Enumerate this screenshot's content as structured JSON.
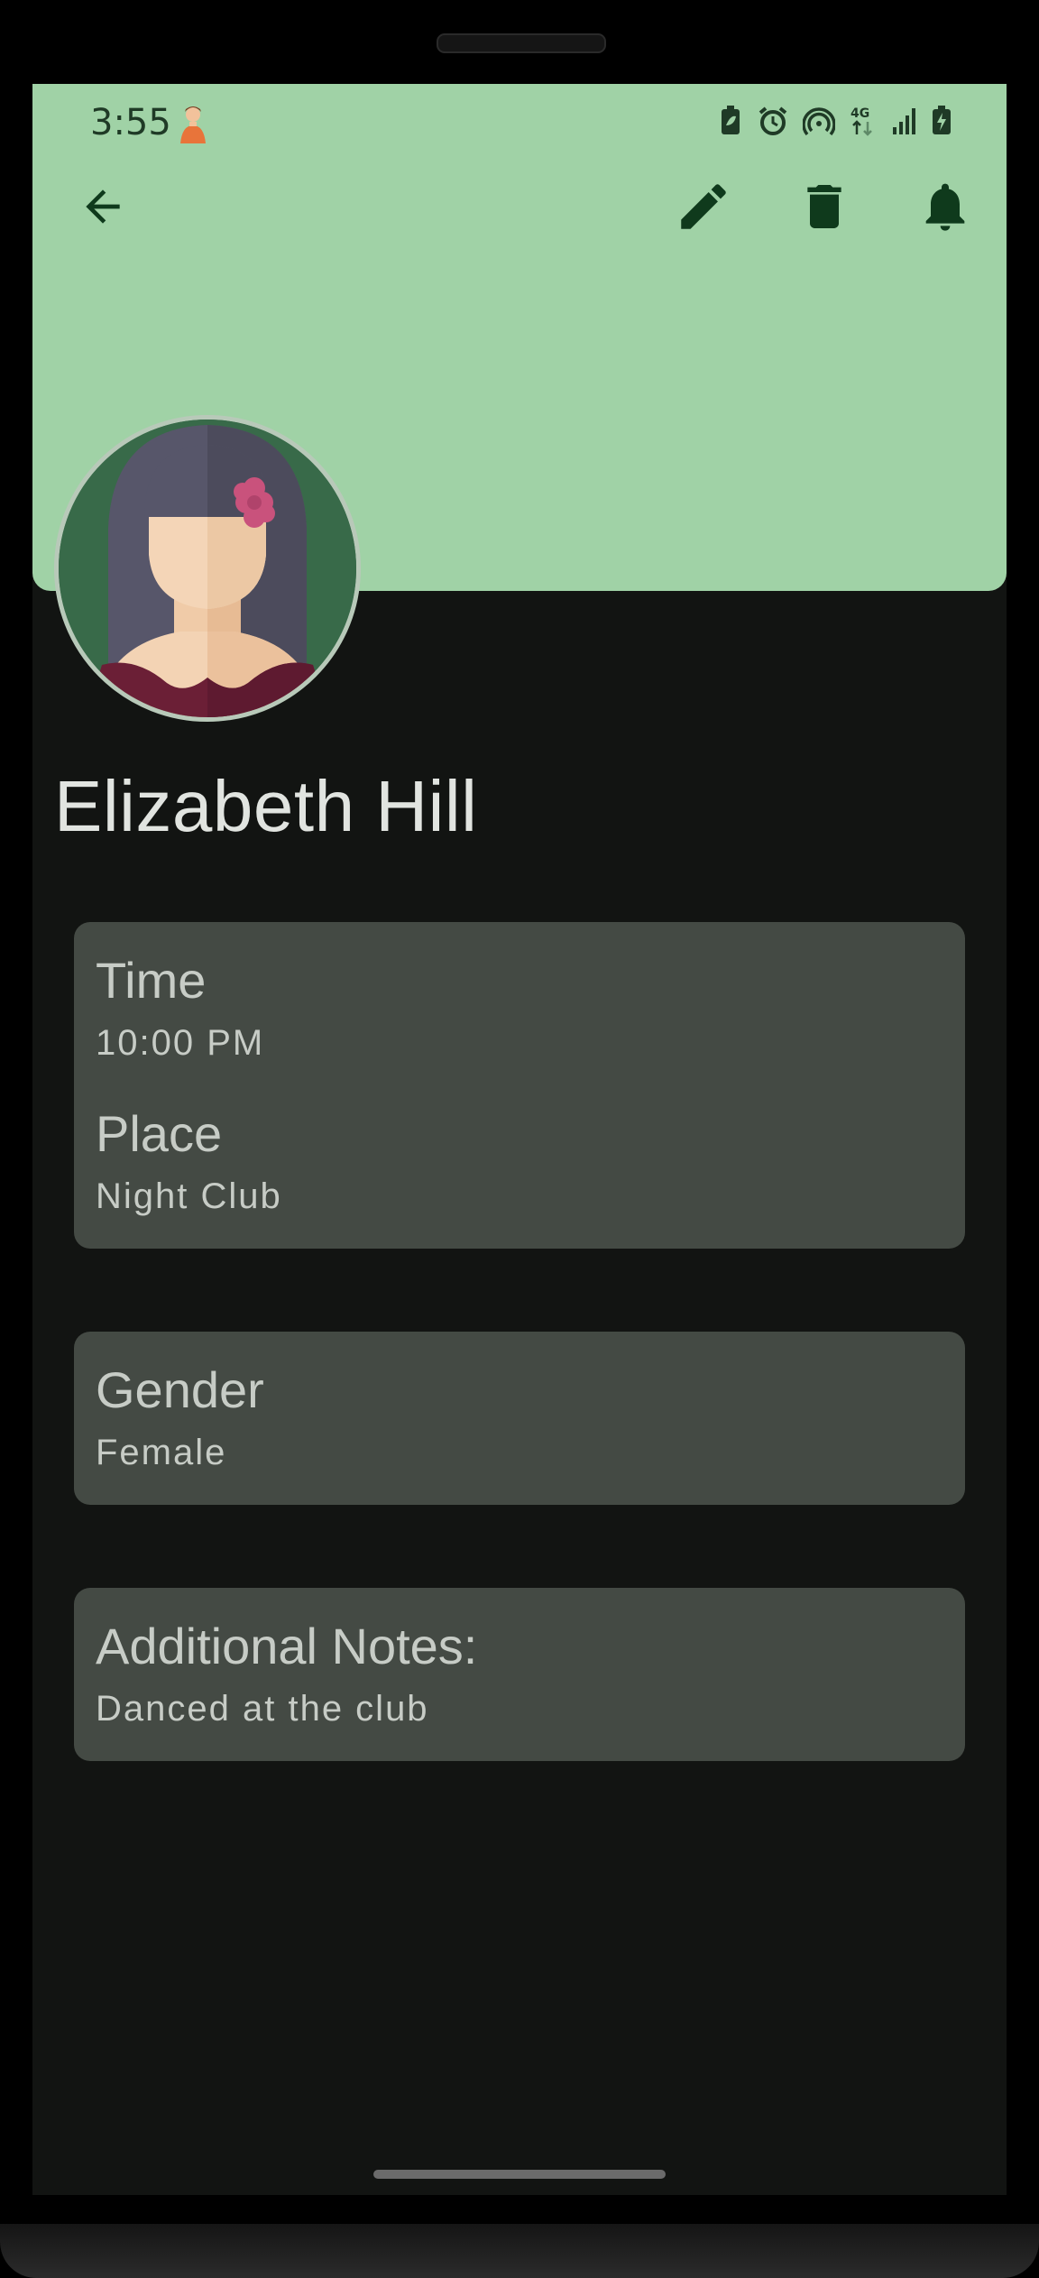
{
  "status_bar": {
    "time": "3:55",
    "network": "4G",
    "icons": [
      "battery-saver-icon",
      "alarm-icon",
      "hotspot-icon",
      "network-4g-icon",
      "signal-icon",
      "battery-charging-icon"
    ]
  },
  "toolbar": {
    "back_icon": "arrow-left-icon",
    "edit_icon": "pencil-icon",
    "delete_icon": "trash-icon",
    "notify_icon": "bell-icon"
  },
  "colors": {
    "header_bg": "#a0d2a6",
    "screen_bg": "#121412",
    "card_bg": "#444a44",
    "icon_dark": "#0f3a1c"
  },
  "contact": {
    "name": "Elizabeth Hill"
  },
  "details": {
    "time_label": "Time",
    "time_value": "10:00 PM",
    "place_label": "Place",
    "place_value": "Night Club",
    "gender_label": "Gender",
    "gender_value": "Female",
    "notes_label": "Additional Notes:",
    "notes_value": "Danced at the club"
  }
}
